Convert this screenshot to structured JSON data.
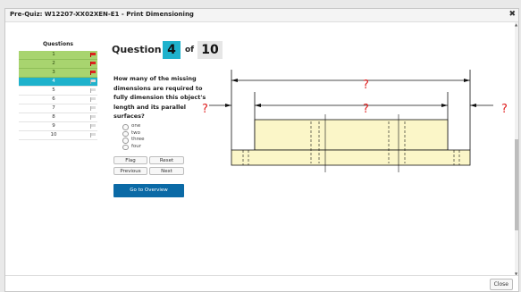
{
  "window": {
    "title": "Pre-Quiz: W12207-XX02XEN-E1 - Print Dimensioning",
    "close_glyph": "✖"
  },
  "sidebar": {
    "header": "Questions",
    "items": [
      {
        "label": "1",
        "status": "answered",
        "flag": "flagged"
      },
      {
        "label": "2",
        "status": "answered",
        "flag": "flagged"
      },
      {
        "label": "3",
        "status": "answered",
        "flag": "flagged"
      },
      {
        "label": "4",
        "status": "current",
        "flag": "none"
      },
      {
        "label": "5",
        "status": "unanswered",
        "flag": "none"
      },
      {
        "label": "6",
        "status": "unanswered",
        "flag": "none"
      },
      {
        "label": "7",
        "status": "unanswered",
        "flag": "none"
      },
      {
        "label": "8",
        "status": "unanswered",
        "flag": "none"
      },
      {
        "label": "9",
        "status": "unanswered",
        "flag": "none"
      },
      {
        "label": "10",
        "status": "unanswered",
        "flag": "none"
      }
    ]
  },
  "question": {
    "label": "Question",
    "current": "4",
    "of": "of",
    "total": "10",
    "text": "How many of the missing dimensions are required to fully dimension this object's length and its parallel surfaces?",
    "options": [
      "one",
      "two",
      "three",
      "four"
    ]
  },
  "buttons": {
    "flag": "Flag",
    "reset": "Reset",
    "previous": "Previous",
    "next": "Next",
    "overview": "Go to Overview",
    "close": "Close"
  },
  "drawing": {
    "markers": [
      "?",
      "?",
      "?",
      "?"
    ],
    "colors": {
      "marker": "#e02020",
      "part_fill": "#fbf6c8",
      "line": "#111111"
    }
  },
  "colors": {
    "answered": "#a8d46f",
    "current": "#1fb2cc",
    "flag_red": "#e02020",
    "overview_button": "#0b6aa6"
  }
}
